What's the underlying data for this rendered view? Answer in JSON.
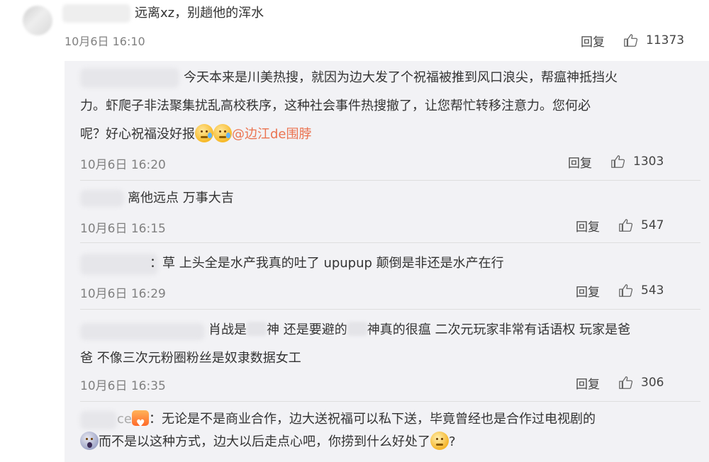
{
  "top_comment": {
    "text": "远离xz，别趟他的浑水",
    "time": "10月6日 16:10",
    "reply_label": "回复",
    "likes": "11373"
  },
  "replies": [
    {
      "lines": [
        "今天本来是川美热搜，就因为边大发了个祝福被推到风口浪尖，帮瘟神抵挡火",
        "力。虾爬子非法聚集扰乱高校秩序，这种社会事件热搜撤了，让您帮忙转移注意力。您何必",
        "呢？好心祝福没好报"
      ],
      "mention": "@边江de围脖",
      "time": "10月6日 16:20",
      "reply_label": "回复",
      "likes": "1303"
    },
    {
      "text": "离他远点 万事大吉",
      "time": "10月6日 16:15",
      "reply_label": "回复",
      "likes": "547"
    },
    {
      "text": "：草 上头全是水产我真的吐了 upupup 颠倒是非还是水产在行",
      "time": "10月6日 16:29",
      "reply_label": "回复",
      "likes": "543"
    },
    {
      "line1_a": "肖战是",
      "line1_b": "神 还是要避的",
      "line1_c": "神真的很瘟 二次元玩家非常有话语权 玩家是爸",
      "line2": "爸 不像三次元粉圈粉丝是奴隶数据女工",
      "time": "10月6日 16:35",
      "reply_label": "回复",
      "likes": "306"
    },
    {
      "name_tail": "ce",
      "line1": "：无论是不是商业合作，边大送祝福可以私下送，毕竟曾经也是合作过电视剧的",
      "line2": "而不是以这种方式，边大以后走点心吧，你捞到什么好处了",
      "line2_end": "?"
    }
  ],
  "icons": {
    "like": "thumbs-up-icon"
  },
  "colors": {
    "mention": "#eb7350",
    "time": "#808080",
    "reply_bg": "#f2f2f5"
  }
}
